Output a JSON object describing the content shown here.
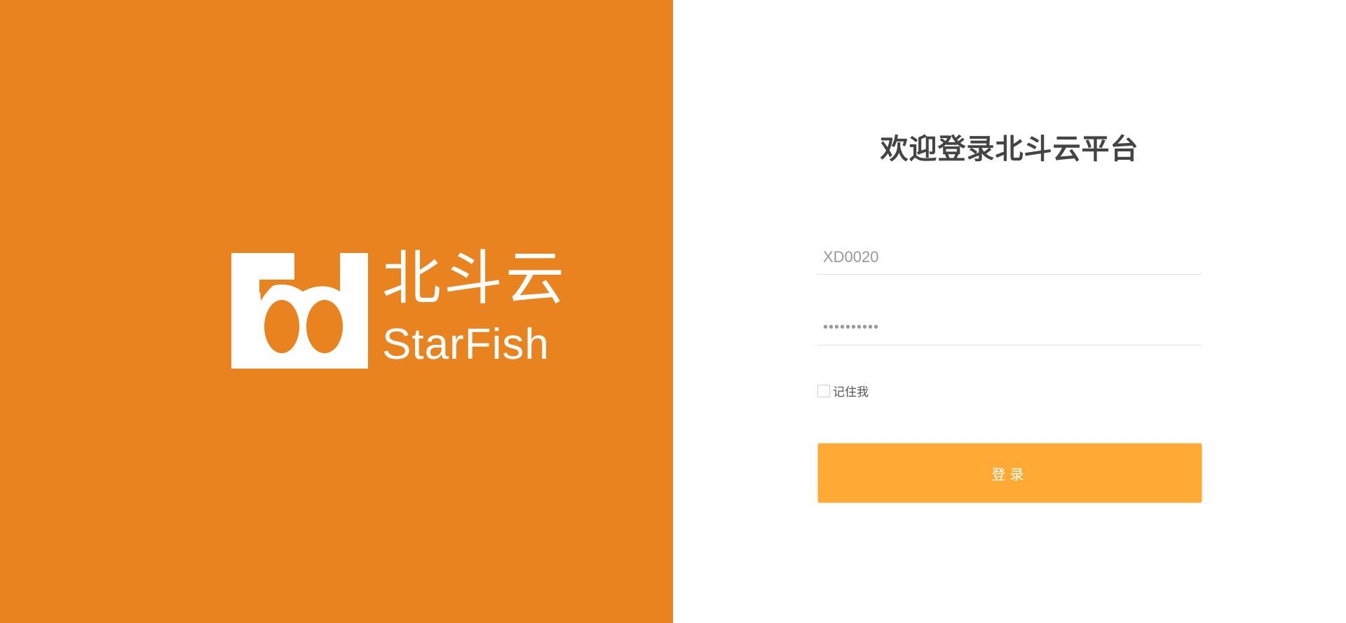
{
  "brand": {
    "name_cn": "北斗云",
    "name_en": "StarFish",
    "color": "#E8831F"
  },
  "login": {
    "title": "欢迎登录北斗云平台",
    "username": {
      "value": "XD0020"
    },
    "password": {
      "value": "••••••••••"
    },
    "remember_label": "记住我",
    "remember_checked": false,
    "submit_label": "登录",
    "accent_color": "#FEAA35"
  }
}
